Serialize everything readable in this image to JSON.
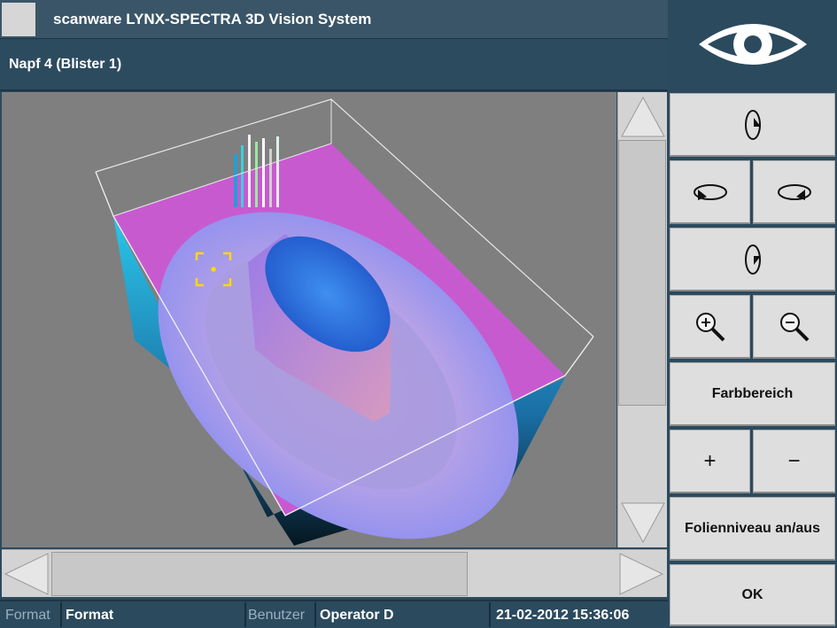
{
  "window": {
    "title": "scanware LYNX-SPECTRA 3D Vision System",
    "subtitle": "Napf 4 (Blister 1)"
  },
  "sidebar": {
    "logo_icon": "eye-icon",
    "buttons": {
      "rotate_up_icon": "rotate-vertical-up-icon",
      "rotate_left_icon": "rotate-horizontal-left-icon",
      "rotate_right_icon": "rotate-horizontal-right-icon",
      "rotate_down_icon": "rotate-vertical-down-icon",
      "zoom_in_icon": "zoom-in-icon",
      "zoom_out_icon": "zoom-out-icon",
      "color_range_label": "Farbbereich",
      "plus_label": "+",
      "minus_label": "−",
      "foil_level_label": "Folienniveau an/aus",
      "ok_label": "OK"
    }
  },
  "statusbar": {
    "format_label": "Format",
    "format_value": "Format",
    "user_label": "Benutzer",
    "user_value": "Operator D",
    "datetime": "21-02-2012 15:36:06"
  },
  "colors": {
    "panel": "#2b4a5e",
    "button": "#dedede",
    "viewport": "#7f7f7f",
    "marker": "#ffd800"
  }
}
